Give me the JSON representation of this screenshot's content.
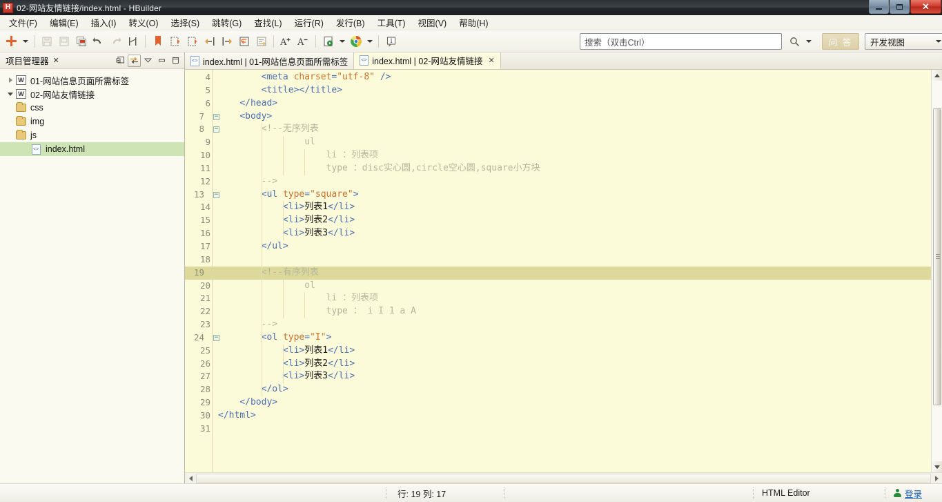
{
  "window": {
    "title": "02-网站友情链接/index.html  -  HBuilder",
    "app_icon": "H",
    "minimize_label": "最小化",
    "maximize_label": "最大化",
    "close_label": "关闭"
  },
  "menubar": {
    "items": [
      {
        "label": "文件(F)",
        "name": "menu-file"
      },
      {
        "label": "编辑(E)",
        "name": "menu-edit"
      },
      {
        "label": "插入(I)",
        "name": "menu-insert"
      },
      {
        "label": "转义(O)",
        "name": "menu-escape"
      },
      {
        "label": "选择(S)",
        "name": "menu-select"
      },
      {
        "label": "跳转(G)",
        "name": "menu-goto"
      },
      {
        "label": "查找(L)",
        "name": "menu-find"
      },
      {
        "label": "运行(R)",
        "name": "menu-run"
      },
      {
        "label": "发行(B)",
        "name": "menu-publish"
      },
      {
        "label": "工具(T)",
        "name": "menu-tools"
      },
      {
        "label": "视图(V)",
        "name": "menu-view"
      },
      {
        "label": "帮助(H)",
        "name": "menu-help"
      }
    ]
  },
  "toolbar": {
    "new_label": "新建",
    "new_dropdown_label": "新建下拉",
    "save_label": "保存",
    "save_as_label": "另存为",
    "save_all_label": "全部保存",
    "undo_label": "撤销",
    "redo_label": "重做",
    "history_label": "历史",
    "bookmark_label": "书签",
    "prev_edit_label": "上一编辑位置",
    "next_edit_label": "下一编辑位置",
    "back_label": "后退",
    "forward_label": "前进",
    "wrap_label": "自动换行",
    "format_label": "格式化",
    "font_bigger_label": "增大字体",
    "font_smaller_label": "减小字体",
    "preview_label": "预览",
    "preview_dropdown_label": "预览下拉",
    "browser_label": "Chrome浏览器运行",
    "browser_dropdown_label": "浏览器下拉",
    "info_label": "信息"
  },
  "search": {
    "placeholder": "搜索（双击Ctrl）",
    "value": "",
    "icon": "search-icon",
    "dropdown_icon": "chevron-down-icon",
    "qa_button_label": "问 答",
    "view_selector_value": "开发视图"
  },
  "project_panel": {
    "title": "项目管理器",
    "close_glyph": "✕",
    "tools": [
      {
        "name": "collapse-all-icon",
        "label": "全部折叠"
      },
      {
        "name": "link-with-editor-icon",
        "label": "与编辑器联动",
        "pressed": true
      },
      {
        "name": "view-menu-icon",
        "label": "视图菜单"
      },
      {
        "name": "minimize-panel-icon",
        "label": "最小化"
      },
      {
        "name": "maximize-panel-icon",
        "label": "最大化"
      }
    ],
    "tree": [
      {
        "label": "01-网站信息页面所需标签",
        "icon": "web-project-icon",
        "level": 0,
        "expanded": false,
        "selected": false
      },
      {
        "label": "02-网站友情链接",
        "icon": "web-project-icon",
        "level": 0,
        "expanded": true,
        "selected": false
      },
      {
        "label": "css",
        "icon": "folder-icon",
        "level": 1,
        "selected": false
      },
      {
        "label": "img",
        "icon": "folder-icon",
        "level": 1,
        "selected": false
      },
      {
        "label": "js",
        "icon": "folder-icon",
        "level": 1,
        "selected": false
      },
      {
        "label": "index.html",
        "icon": "html-file-icon",
        "level": 2,
        "selected": true
      }
    ]
  },
  "editor": {
    "tabs": [
      {
        "label": "index.html | 01-网站信息页面所需标签",
        "icon": "html-file-icon",
        "active": false,
        "closable": false
      },
      {
        "label": "index.html | 02-网站友情链接",
        "icon": "html-file-icon",
        "active": true,
        "closable": true,
        "close_glyph": "✕"
      }
    ],
    "first_visible_line": 4,
    "highlighted_line": 19,
    "lines": [
      {
        "n": 4,
        "fold": false,
        "indent_guides": [],
        "tokens": [
          {
            "t": "plain",
            "v": "        "
          },
          {
            "t": "tag",
            "v": "<meta "
          },
          {
            "t": "attr",
            "v": "charset"
          },
          {
            "t": "tag",
            "v": "="
          },
          {
            "t": "str",
            "v": "\"utf-8\""
          },
          {
            "t": "tag",
            "v": " />"
          }
        ]
      },
      {
        "n": 5,
        "fold": false,
        "indent_guides": [],
        "tokens": [
          {
            "t": "plain",
            "v": "        "
          },
          {
            "t": "tag",
            "v": "<title></title>"
          }
        ]
      },
      {
        "n": 6,
        "fold": false,
        "indent_guides": [],
        "tokens": [
          {
            "t": "plain",
            "v": "    "
          },
          {
            "t": "tag",
            "v": "</head>"
          }
        ]
      },
      {
        "n": 7,
        "fold": true,
        "indent_guides": [],
        "tokens": [
          {
            "t": "plain",
            "v": "    "
          },
          {
            "t": "tag",
            "v": "<body>"
          }
        ]
      },
      {
        "n": 8,
        "fold": true,
        "indent_guides": [
          1
        ],
        "tokens": [
          {
            "t": "plain",
            "v": "        "
          },
          {
            "t": "cmt",
            "v": "<!--无序列表"
          }
        ]
      },
      {
        "n": 9,
        "fold": false,
        "indent_guides": [
          1,
          2
        ],
        "tokens": [
          {
            "t": "plain",
            "v": "                "
          },
          {
            "t": "cmt",
            "v": "ul"
          }
        ]
      },
      {
        "n": 10,
        "fold": false,
        "indent_guides": [
          1,
          2,
          3
        ],
        "tokens": [
          {
            "t": "plain",
            "v": "                    "
          },
          {
            "t": "cmt",
            "v": "li ：列表项"
          }
        ]
      },
      {
        "n": 11,
        "fold": false,
        "indent_guides": [
          1,
          2,
          3
        ],
        "tokens": [
          {
            "t": "plain",
            "v": "                    "
          },
          {
            "t": "cmt",
            "v": "type ：disc实心圆,circle空心圆,square小方块"
          }
        ]
      },
      {
        "n": 12,
        "fold": false,
        "indent_guides": [
          1
        ],
        "tokens": [
          {
            "t": "plain",
            "v": "        "
          },
          {
            "t": "cmt",
            "v": "-->"
          }
        ]
      },
      {
        "n": 13,
        "fold": true,
        "indent_guides": [
          1
        ],
        "tokens": [
          {
            "t": "plain",
            "v": "        "
          },
          {
            "t": "tag",
            "v": "<ul "
          },
          {
            "t": "attr",
            "v": "type"
          },
          {
            "t": "tag",
            "v": "="
          },
          {
            "t": "str",
            "v": "\"square\""
          },
          {
            "t": "tag",
            "v": ">"
          }
        ]
      },
      {
        "n": 14,
        "fold": false,
        "indent_guides": [
          1,
          2
        ],
        "tokens": [
          {
            "t": "plain",
            "v": "            "
          },
          {
            "t": "tag",
            "v": "<li>"
          },
          {
            "t": "txt",
            "v": "列表1"
          },
          {
            "t": "tag",
            "v": "</li>"
          }
        ]
      },
      {
        "n": 15,
        "fold": false,
        "indent_guides": [
          1,
          2
        ],
        "tokens": [
          {
            "t": "plain",
            "v": "            "
          },
          {
            "t": "tag",
            "v": "<li>"
          },
          {
            "t": "txt",
            "v": "列表2"
          },
          {
            "t": "tag",
            "v": "</li>"
          }
        ]
      },
      {
        "n": 16,
        "fold": false,
        "indent_guides": [
          1,
          2
        ],
        "tokens": [
          {
            "t": "plain",
            "v": "            "
          },
          {
            "t": "tag",
            "v": "<li>"
          },
          {
            "t": "txt",
            "v": "列表3"
          },
          {
            "t": "tag",
            "v": "</li>"
          }
        ]
      },
      {
        "n": 17,
        "fold": false,
        "indent_guides": [
          1
        ],
        "tokens": [
          {
            "t": "plain",
            "v": "        "
          },
          {
            "t": "tag",
            "v": "</ul>"
          }
        ]
      },
      {
        "n": 18,
        "fold": false,
        "indent_guides": [
          1
        ],
        "tokens": [
          {
            "t": "plain",
            "v": ""
          }
        ]
      },
      {
        "n": 19,
        "fold": true,
        "indent_guides": [
          1
        ],
        "tokens": [
          {
            "t": "plain",
            "v": "        "
          },
          {
            "t": "cmt",
            "v": "<!--有序列表"
          }
        ]
      },
      {
        "n": 20,
        "fold": false,
        "indent_guides": [
          1,
          2
        ],
        "tokens": [
          {
            "t": "plain",
            "v": "                "
          },
          {
            "t": "cmt",
            "v": "ol"
          }
        ]
      },
      {
        "n": 21,
        "fold": false,
        "indent_guides": [
          1,
          2,
          3
        ],
        "tokens": [
          {
            "t": "plain",
            "v": "                    "
          },
          {
            "t": "cmt",
            "v": "li ：列表项"
          }
        ]
      },
      {
        "n": 22,
        "fold": false,
        "indent_guides": [
          1,
          2,
          3
        ],
        "tokens": [
          {
            "t": "plain",
            "v": "                    "
          },
          {
            "t": "cmt",
            "v": "type ： i I 1 a A"
          }
        ]
      },
      {
        "n": 23,
        "fold": false,
        "indent_guides": [
          1
        ],
        "tokens": [
          {
            "t": "plain",
            "v": "        "
          },
          {
            "t": "cmt",
            "v": "-->"
          }
        ]
      },
      {
        "n": 24,
        "fold": true,
        "indent_guides": [
          1
        ],
        "tokens": [
          {
            "t": "plain",
            "v": "        "
          },
          {
            "t": "tag",
            "v": "<ol "
          },
          {
            "t": "attr",
            "v": "type"
          },
          {
            "t": "tag",
            "v": "="
          },
          {
            "t": "str",
            "v": "\"I\""
          },
          {
            "t": "tag",
            "v": ">"
          }
        ]
      },
      {
        "n": 25,
        "fold": false,
        "indent_guides": [
          1,
          2
        ],
        "tokens": [
          {
            "t": "plain",
            "v": "            "
          },
          {
            "t": "tag",
            "v": "<li>"
          },
          {
            "t": "txt",
            "v": "列表1"
          },
          {
            "t": "tag",
            "v": "</li>"
          }
        ]
      },
      {
        "n": 26,
        "fold": false,
        "indent_guides": [
          1,
          2
        ],
        "tokens": [
          {
            "t": "plain",
            "v": "            "
          },
          {
            "t": "tag",
            "v": "<li>"
          },
          {
            "t": "txt",
            "v": "列表2"
          },
          {
            "t": "tag",
            "v": "</li>"
          }
        ]
      },
      {
        "n": 27,
        "fold": false,
        "indent_guides": [
          1,
          2
        ],
        "tokens": [
          {
            "t": "plain",
            "v": "            "
          },
          {
            "t": "tag",
            "v": "<li>"
          },
          {
            "t": "txt",
            "v": "列表3"
          },
          {
            "t": "tag",
            "v": "</li>"
          }
        ]
      },
      {
        "n": 28,
        "fold": false,
        "indent_guides": [
          1
        ],
        "tokens": [
          {
            "t": "plain",
            "v": "        "
          },
          {
            "t": "tag",
            "v": "</ol>"
          }
        ]
      },
      {
        "n": 29,
        "fold": false,
        "indent_guides": [],
        "tokens": [
          {
            "t": "plain",
            "v": "    "
          },
          {
            "t": "tag",
            "v": "</body>"
          }
        ]
      },
      {
        "n": 30,
        "fold": false,
        "indent_guides": [],
        "tokens": [
          {
            "t": "tag",
            "v": "</html>"
          }
        ]
      },
      {
        "n": 31,
        "fold": false,
        "indent_guides": [],
        "tokens": [
          {
            "t": "plain",
            "v": ""
          }
        ]
      }
    ]
  },
  "statusbar": {
    "position": "行: 19 列: 17",
    "editor_mode": "HTML Editor",
    "login_label": "登录",
    "login_icon": "user-icon"
  },
  "colors": {
    "editor_background": "#fcfbd9",
    "highlight_line": "#ddd99a",
    "selection_green": "#cfe4b4",
    "tag_blue": "#4b6fb0",
    "attr_orange": "#c9712b",
    "comment_gray": "#b6b69c",
    "accent_red": "#c0342a"
  }
}
